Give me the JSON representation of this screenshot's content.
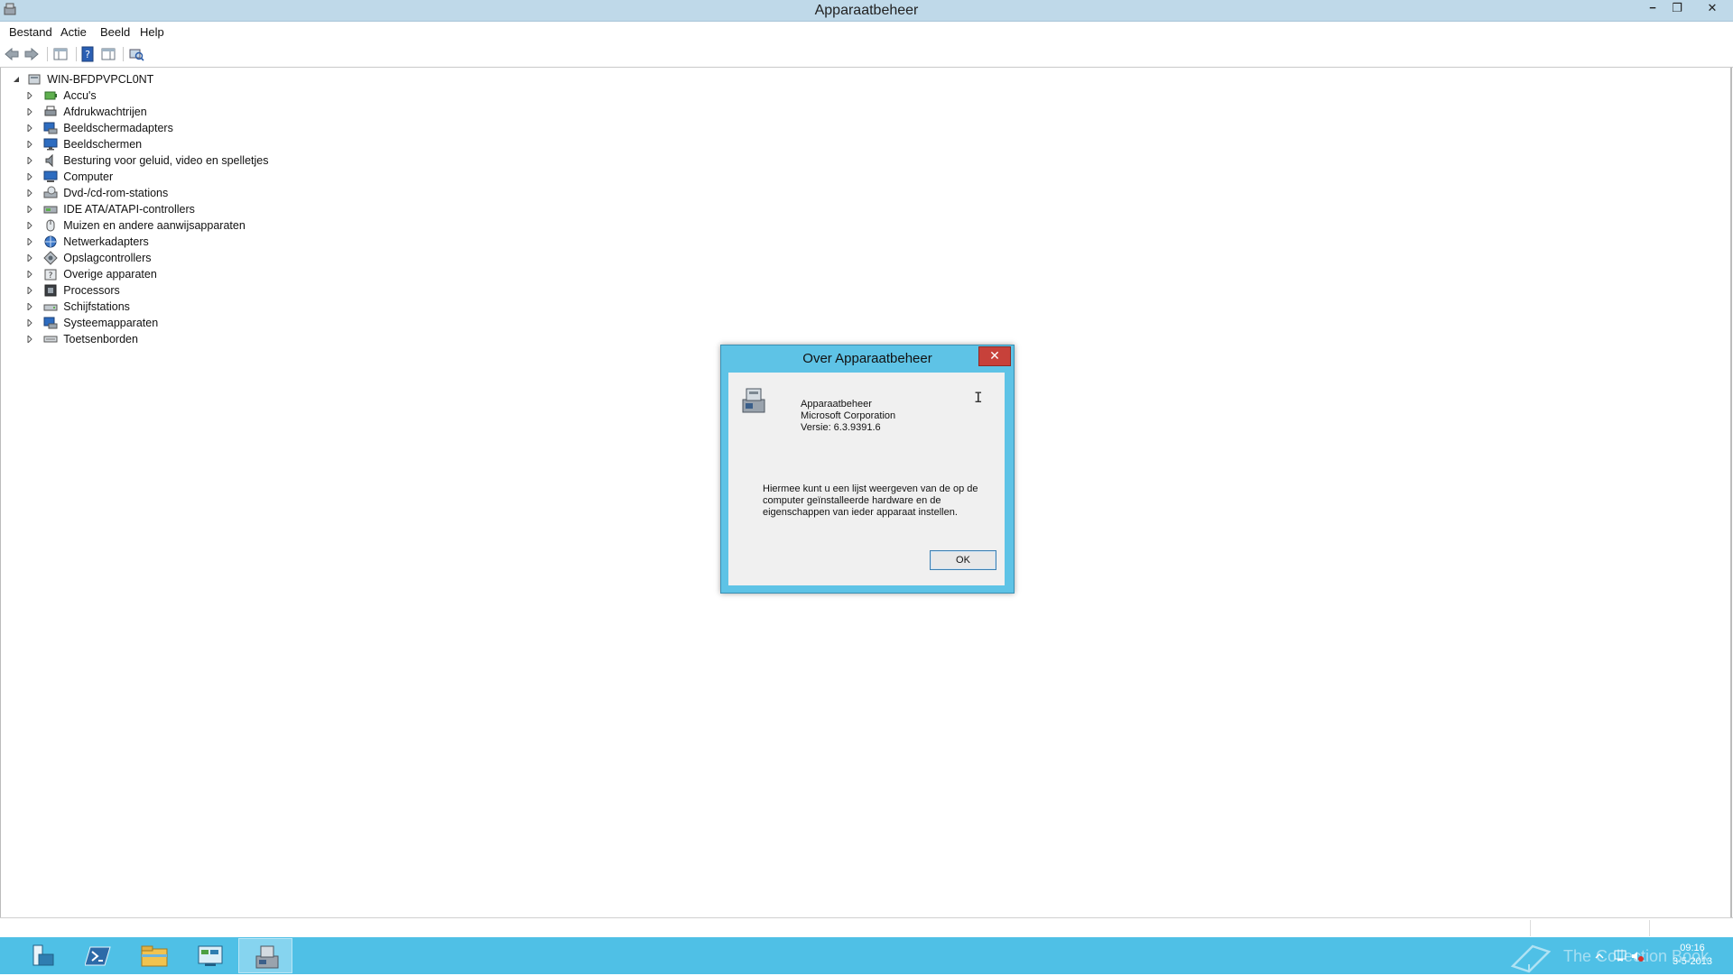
{
  "window": {
    "title": "Apparaatbeheer",
    "controls": {
      "minimize": "−",
      "maximize": "❐",
      "close": "✕"
    }
  },
  "menu": {
    "items": [
      "Bestand",
      "Actie",
      "Beeld",
      "Help"
    ]
  },
  "toolbar": {
    "buttons": [
      "back-arrow-icon",
      "forward-arrow-icon",
      "show-hide-console-tree-icon",
      "help-icon",
      "properties-pane-icon",
      "scan-hardware-icon"
    ]
  },
  "tree": {
    "root": "WIN-BFDPVPCL0NT",
    "items": [
      "Accu's",
      "Afdrukwachtrijen",
      "Beeldschermadapters",
      "Beeldschermen",
      "Besturing voor geluid, video en spelletjes",
      "Computer",
      "Dvd-/cd-rom-stations",
      "IDE ATA/ATAPI-controllers",
      "Muizen en andere aanwijsapparaten",
      "Netwerkadapters",
      "Opslagcontrollers",
      "Overige apparaten",
      "Processors",
      "Schijfstations",
      "Systeemapparaten",
      "Toetsenborden"
    ]
  },
  "dialog": {
    "title": "Over Apparaatbeheer",
    "close": "✕",
    "app_name": "Apparaatbeheer",
    "company": "Microsoft Corporation",
    "version": "Versie: 6.3.9391.6",
    "description": "Hiermee kunt u een lijst weergeven van de op de computer geïnstalleerde hardware en de eigenschappen van ieder apparaat instellen.",
    "ok_label": "OK"
  },
  "taskbar": {
    "pinned": [
      "server-manager-icon",
      "powershell-icon",
      "file-explorer-icon",
      "control-panel-icon",
      "device-manager-icon"
    ],
    "active": "device-manager-icon",
    "watermark": "The Collection Book",
    "clock_time": "09:16",
    "clock_date": "3-5-2013",
    "colors": {
      "taskbar": "#4fc0e6",
      "dialog_frame": "#5ec3e6",
      "close_red": "#c7413a"
    }
  }
}
